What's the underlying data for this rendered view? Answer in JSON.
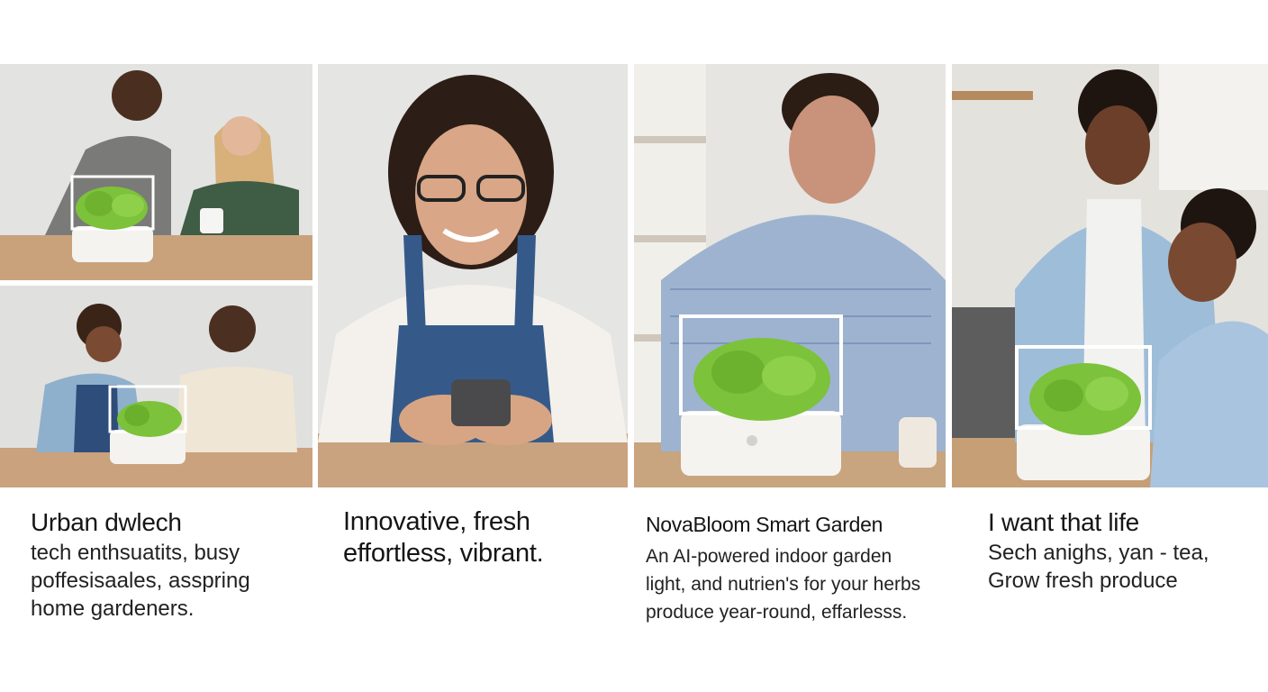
{
  "panels": [
    {
      "caption_title": "Urban dwlech",
      "caption_lines": [
        "tech enthsuatits, busy",
        "poffesisaales, asspring",
        "home gardeners."
      ]
    },
    {
      "caption_title_lines": [
        "Innovative, fresh",
        "effortless, vibrant."
      ]
    },
    {
      "caption_title": "NovaBloom Smart Garden",
      "caption_lines": [
        "An AI-powered indoor garden",
        "light, and nutrien's for your herbs",
        "produce year-round, effarlesss."
      ]
    },
    {
      "caption_title": "I want that life",
      "caption_lines": [
        "Sech anighs, yan - tea,",
        "Grow fresh produce"
      ]
    }
  ],
  "colors": {
    "plant": "#7cc23a",
    "planter": "#f4f3f0",
    "table": "#c9a27c",
    "wall": "#e2e2e0"
  }
}
